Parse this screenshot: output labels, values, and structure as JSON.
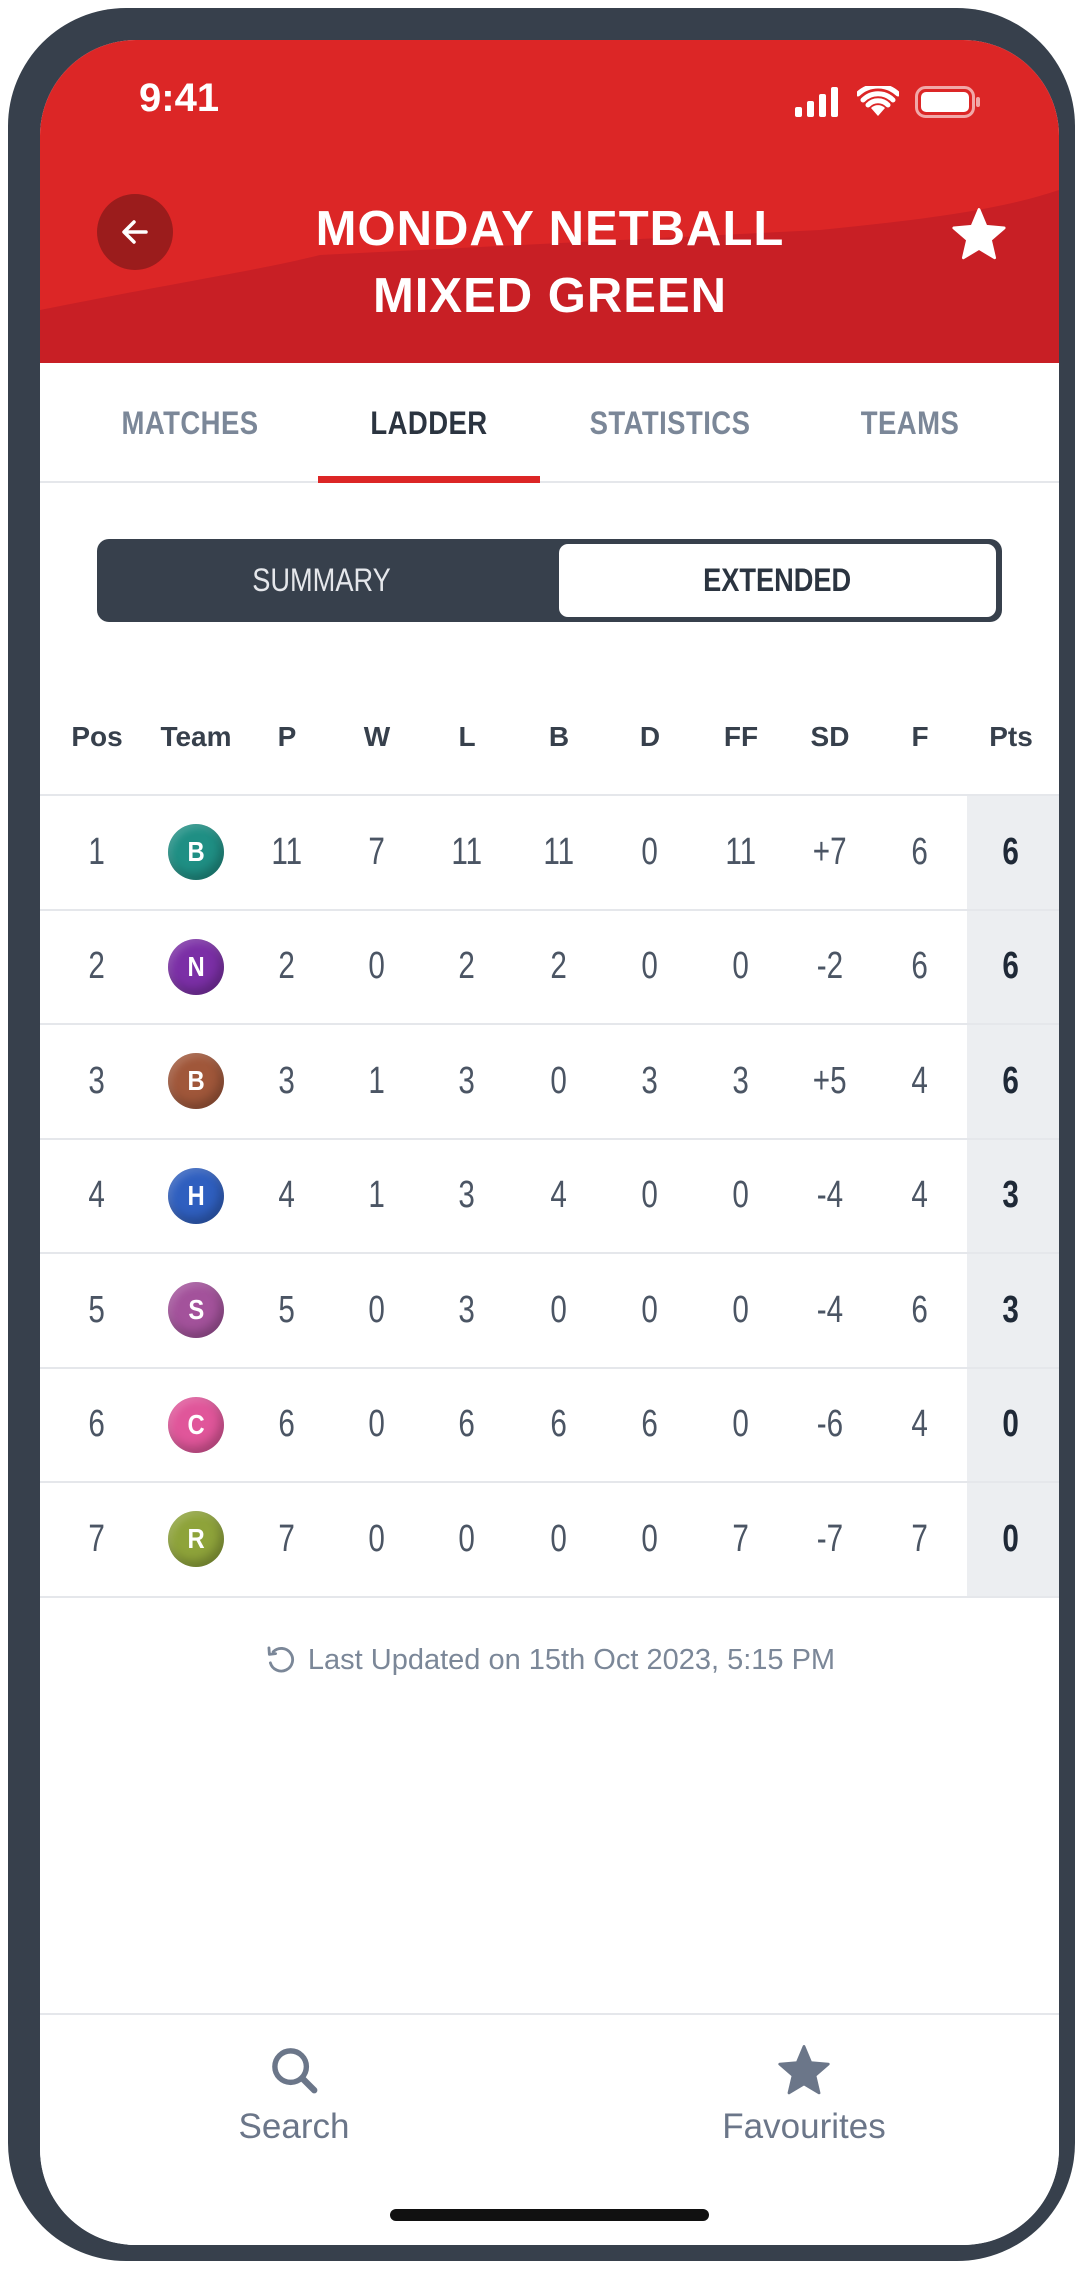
{
  "status_bar": {
    "time": "9:41"
  },
  "header": {
    "title_line1": "MONDAY NETBALL",
    "title_line2": "MIXED GREEN",
    "back_icon": "arrow-left-icon",
    "favourite_icon": "star-icon"
  },
  "tabs": [
    {
      "label": "MATCHES",
      "active": false
    },
    {
      "label": "LADDER",
      "active": true
    },
    {
      "label": "STATISTICS",
      "active": false
    },
    {
      "label": "TEAMS",
      "active": false
    }
  ],
  "segment": {
    "summary": "SUMMARY",
    "extended": "EXTENDED",
    "selected": "EXTENDED"
  },
  "ladder": {
    "columns": [
      "Pos",
      "Team",
      "P",
      "W",
      "L",
      "B",
      "D",
      "FF",
      "SD",
      "F",
      "Pts"
    ],
    "rows": [
      {
        "pos": "1",
        "team_initial": "B",
        "team_color": "#1f8f84",
        "p": "11",
        "w": "7",
        "l": "11",
        "b": "11",
        "d": "0",
        "ff": "11",
        "sd": "+7",
        "f": "6",
        "pts": "6"
      },
      {
        "pos": "2",
        "team_initial": "N",
        "team_color": "#7b2fa6",
        "p": "2",
        "w": "0",
        "l": "2",
        "b": "2",
        "d": "0",
        "ff": "0",
        "sd": "-2",
        "f": "6",
        "pts": "6"
      },
      {
        "pos": "3",
        "team_initial": "B",
        "team_color": "#a0573a",
        "p": "3",
        "w": "1",
        "l": "3",
        "b": "0",
        "d": "3",
        "ff": "3",
        "sd": "+5",
        "f": "4",
        "pts": "6"
      },
      {
        "pos": "4",
        "team_initial": "H",
        "team_color": "#2f5fbf",
        "p": "4",
        "w": "1",
        "l": "3",
        "b": "4",
        "d": "0",
        "ff": "0",
        "sd": "-4",
        "f": "4",
        "pts": "3"
      },
      {
        "pos": "5",
        "team_initial": "S",
        "team_color": "#a3529b",
        "p": "5",
        "w": "0",
        "l": "3",
        "b": "0",
        "d": "0",
        "ff": "0",
        "sd": "-4",
        "f": "6",
        "pts": "3"
      },
      {
        "pos": "6",
        "team_initial": "C",
        "team_color": "#e0569a",
        "p": "6",
        "w": "0",
        "l": "6",
        "b": "6",
        "d": "6",
        "ff": "0",
        "sd": "-6",
        "f": "4",
        "pts": "0"
      },
      {
        "pos": "7",
        "team_initial": "R",
        "team_color": "#8ea33a",
        "p": "7",
        "w": "0",
        "l": "0",
        "b": "0",
        "d": "0",
        "ff": "7",
        "sd": "-7",
        "f": "7",
        "pts": "0"
      }
    ]
  },
  "last_updated": {
    "text": "Last Updated on 15th Oct 2023, 5:15 PM",
    "icon": "refresh-icon"
  },
  "bottom_nav": [
    {
      "label": "Search",
      "icon": "search-icon"
    },
    {
      "label": "Favourites",
      "icon": "star-icon"
    }
  ]
}
